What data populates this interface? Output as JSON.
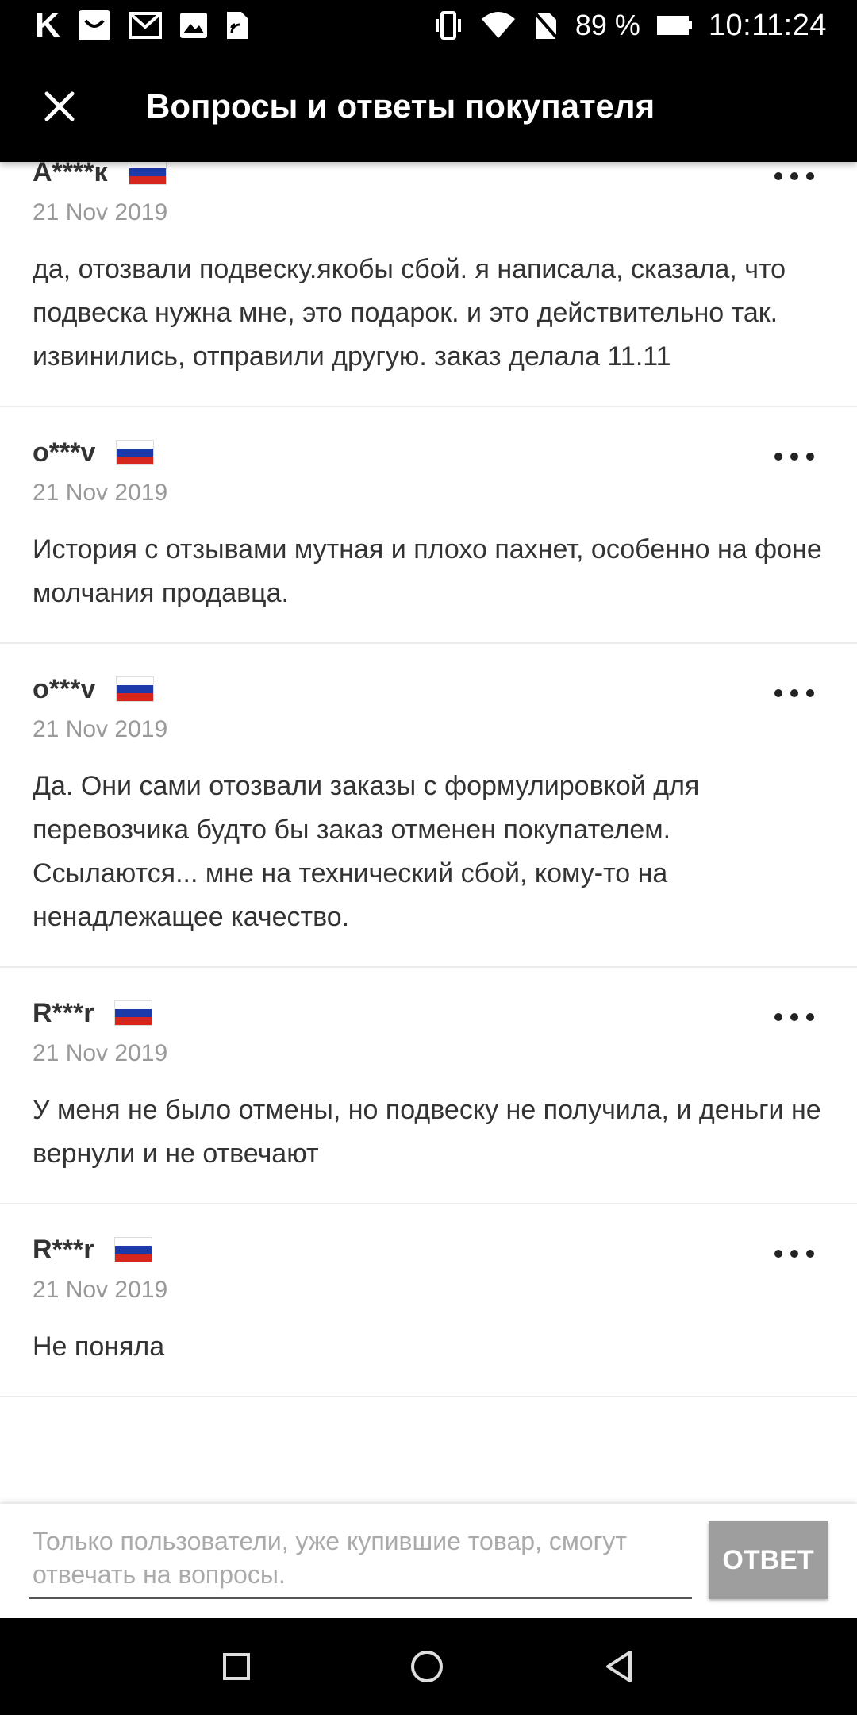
{
  "status_bar": {
    "battery": "89 %",
    "time": "10:11:24"
  },
  "app_bar": {
    "title": "Вопросы и ответы покупателя"
  },
  "entries": [
    {
      "author": "А****к",
      "date": "21 Nov 2019",
      "text": "да, отозвали подвеску.якобы сбой. я написала, сказала, что подвеска нужна мне, это подарок. и это действительно так. извинились, отправили другую. заказ делала 11.11"
    },
    {
      "author": "o***v",
      "date": "21 Nov 2019",
      "text": "История с отзывами мутная и плохо пахнет, особенно на фоне молчания продавца."
    },
    {
      "author": "o***v",
      "date": "21 Nov 2019",
      "text": "Да. Они сами отозвали заказы с формулировкой для перевозчика будто бы заказ отменен покупателем. Ссылаются... мне на технический сбой, кому-то на ненадлежащее качество."
    },
    {
      "author": "R***r",
      "date": "21 Nov 2019",
      "text": "У меня не было отмены, но подвеску не получила, и деньги не вернули и не отвечают"
    },
    {
      "author": "R***r",
      "date": "21 Nov 2019",
      "text": "Не поняла"
    }
  ],
  "answer_box": {
    "placeholder": "Только пользователи, уже купившие товар, смогут отвечать на вопросы.",
    "button_label": "ОТВЕТ"
  },
  "icons": {
    "close": "close-icon",
    "more": "more-horizontal-icon",
    "flag": "russia-flag-icon"
  },
  "colors": {
    "appbar": "#000000",
    "button_disabled": "#9e9e9e",
    "date_text": "#999999"
  }
}
